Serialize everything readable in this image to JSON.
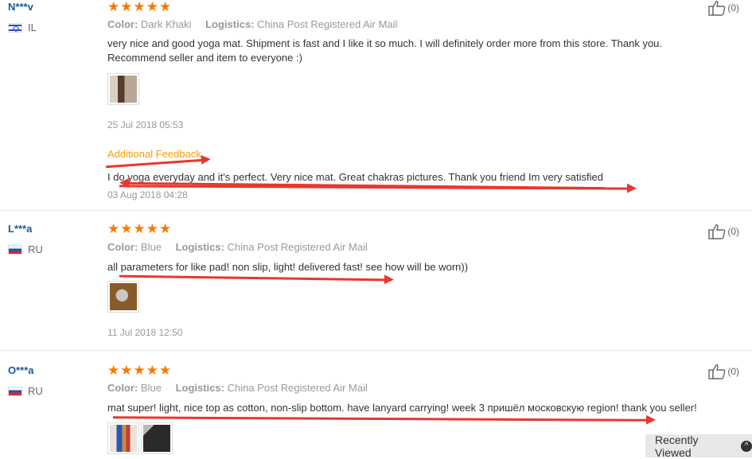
{
  "reviews": [
    {
      "user": "N***v",
      "country": "IL",
      "color_label": "Color:",
      "color_value": "Dark Khaki",
      "logistics_label": "Logistics:",
      "logistics_value": "China Post Registered Air Mail",
      "text_line1": "very nice and good yoga mat. Shipment is fast and I like it so much. I will definitely order more from this store. Thank you.",
      "text_line2": "Recommend seller and item to everyone :)",
      "date": "25 Jul 2018 05:53",
      "additional_label": "Additional Feedback",
      "additional_text": "I do yoga everyday and it's perfect. Very nice mat. Great chakras pictures. Thank you friend Im very satisfied",
      "additional_date": "03 Aug 2018 04:28",
      "likes": "(0)",
      "rating": 5
    },
    {
      "user": "L***a",
      "country": "RU",
      "color_label": "Color:",
      "color_value": "Blue",
      "logistics_label": "Logistics:",
      "logistics_value": "China Post Registered Air Mail",
      "text_line1": "all parameters for like pad! non slip, light! delivered fast! see how will be worn))",
      "date": "11 Jul 2018 12:50",
      "likes": "(0)",
      "rating": 5
    },
    {
      "user": "O***a",
      "country": "RU",
      "color_label": "Color:",
      "color_value": "Blue",
      "logistics_label": "Logistics:",
      "logistics_value": "China Post Registered Air Mail",
      "text_line1": "mat super! light, nice top as cotton, non-slip bottom. have lanyard carrying! week 3 пришёл московскую region! thank you seller!",
      "likes": "(0)",
      "rating": 5
    }
  ],
  "recently_viewed": "Recently Viewed",
  "colors": {
    "star": "#f57a00",
    "arrow": "#e8372e",
    "username": "#1a5a96",
    "additional": "#f39c12"
  }
}
